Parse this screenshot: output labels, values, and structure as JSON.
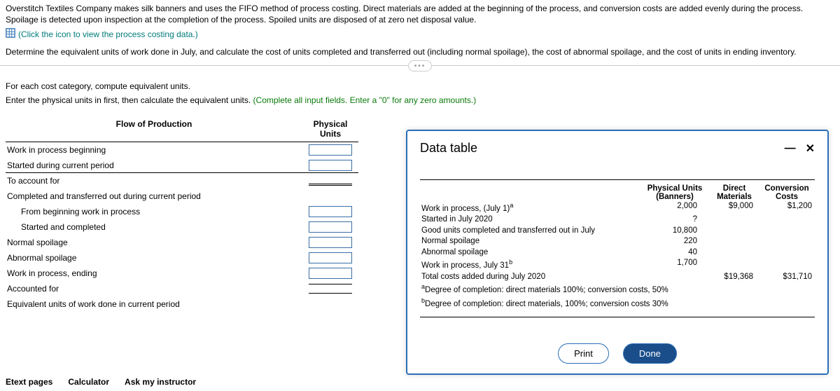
{
  "problem": {
    "p1": "Overstitch Textiles Company makes silk banners and uses the FIFO method of process costing. Direct materials are added at the beginning of the process, and conversion costs are added evenly during the process. Spoilage is detected upon inspection at the completion of the process. Spoiled units are disposed of at zero net disposal value.",
    "link": "(Click the icon to view the process costing data.)",
    "p2": "Determine the equivalent units of work done in July, and calculate the cost of units completed and transferred out (including normal spoilage), the cost of abnormal spoilage, and the cost of units in ending inventory."
  },
  "section": {
    "line1": "For each cost category, compute equivalent units.",
    "line2a": "Enter the physical units in first, then calculate the equivalent units. ",
    "line2b": "(Complete all input fields. Enter a \"0\" for any zero amounts.)"
  },
  "ws": {
    "h1": "Flow of Production",
    "h2a": "Physical",
    "h2b": "Units",
    "r_wip_beg": "Work in process beginning",
    "r_started": "Started during current period",
    "r_account": "To account for",
    "r_cto": "Completed and transferred out during current period",
    "r_from_beg": "From beginning work in process",
    "r_start_comp": "Started and completed",
    "r_norm": "Normal spoilage",
    "r_abn": "Abnormal spoilage",
    "r_wip_end": "Work in process, ending",
    "r_acct_for": "Accounted for",
    "r_eu": "Equivalent units of work done in current period"
  },
  "modal": {
    "title": "Data table",
    "head": {
      "c2a": "Physical Units",
      "c2b": "(Banners)",
      "c3a": "Direct",
      "c3b": "Materials",
      "c4a": "Conversion",
      "c4b": "Costs"
    },
    "rows": {
      "wip1": {
        "label": "Work in process, (July 1)",
        "sup": "a",
        "pu": "2,000",
        "dm": "$9,000",
        "cc": "$1,200"
      },
      "started": {
        "label": "Started in July 2020",
        "pu": "?"
      },
      "good": {
        "label": "Good units completed and transferred out in July",
        "pu": "10,800"
      },
      "norm": {
        "label": "Normal spoilage",
        "pu": "220"
      },
      "abn": {
        "label": "Abnormal spoilage",
        "pu": "40"
      },
      "wip31": {
        "label": "Work in process, July 31",
        "sup": "b",
        "pu": "1,700"
      },
      "total": {
        "label": "Total costs added during July 2020",
        "dm": "$19,368",
        "cc": "$31,710"
      }
    },
    "fn_a": "Degree of completion: direct materials 100%; conversion costs, 50%",
    "fn_b": "Degree of completion: direct materials, 100%; conversion costs 30%",
    "print": "Print",
    "done": "Done"
  },
  "bottom": {
    "etext": "Etext pages",
    "calc": "Calculator",
    "ask": "Ask my instructor"
  }
}
